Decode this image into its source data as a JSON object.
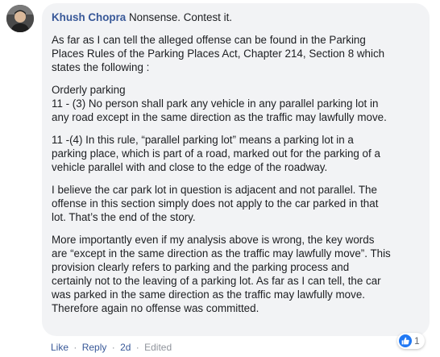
{
  "comment": {
    "author": "Khush Chopra",
    "first_line": "Nonsense. Contest it.",
    "paragraphs": [
      [
        "As far as I can tell the alleged offense can be found in the Parking",
        "Places Rules of the Parking Places Act, Chapter 214, Section 8 which",
        "states the following :"
      ],
      [
        "Orderly parking",
        "11 - (3) No person shall park any vehicle in any parallel parking lot in",
        "any road except in the same direction as the traffic may lawfully move."
      ],
      [
        "11 -(4) In this rule, “parallel parking lot” means a parking lot in a",
        "parking place, which is part of a road, marked out for the parking of a",
        "vehicle parallel with and close to the edge of the roadway."
      ],
      [
        "I believe the car park lot in question is adjacent and not parallel. The",
        "offense in this section simply does not apply to the car parked in that",
        "lot. That’s the end of the story."
      ],
      [
        "More importantly even if my analysis above is wrong, the key words",
        "are “except in the same direction as the traffic may lawfully move”. This",
        "provision clearly refers to parking and the parking process and",
        "certainly not to the leaving of a parking lot. As far as I can tell, the car",
        "was parked in the same direction as the traffic may lawfully move.",
        "Therefore again no offense was committed."
      ]
    ],
    "reaction_icon": "like-icon",
    "reaction_count": "1",
    "actions": {
      "like": "Like",
      "reply": "Reply",
      "time": "2d",
      "edited": "Edited",
      "separator": "·"
    },
    "colors": {
      "author": "#385898",
      "bubble_bg": "#f2f3f5",
      "like_badge": "#2078f4"
    }
  }
}
